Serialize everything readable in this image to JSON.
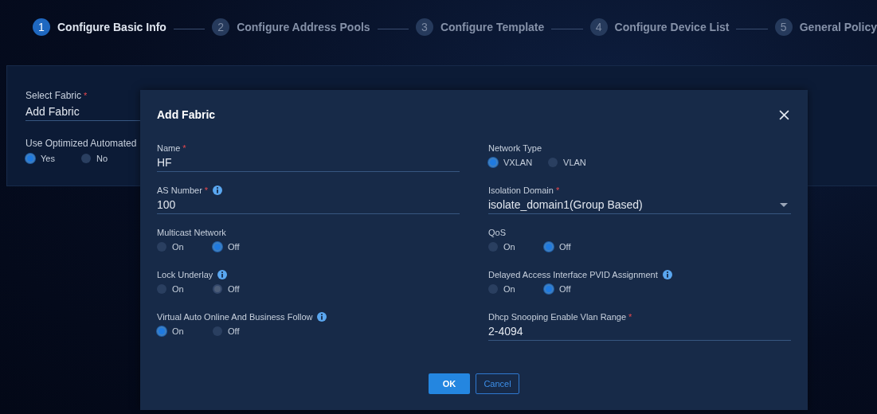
{
  "steps": [
    {
      "number": "1",
      "label": "Configure Basic Info",
      "selected": true
    },
    {
      "number": "2",
      "label": "Configure Address Pools",
      "selected": false
    },
    {
      "number": "3",
      "label": "Configure Template",
      "selected": false
    },
    {
      "number": "4",
      "label": "Configure Device List",
      "selected": false
    },
    {
      "number": "5",
      "label": "General Policy",
      "selected": false
    }
  ],
  "background_form": {
    "fields": [
      {
        "kind": "text",
        "label": "Select Fabric",
        "required_mark": "*",
        "value": "Add Fabric"
      },
      {
        "kind": "radio",
        "label": "Use Optimized Automated",
        "disabled": false,
        "options": [
          {
            "label": "Yes",
            "selected": true
          },
          {
            "label": "No",
            "selected": false
          }
        ]
      }
    ]
  },
  "dialog": {
    "title": "Add Fabric",
    "left_column": [
      {
        "kind": "text",
        "label": "Name",
        "required_mark": "*",
        "value": "HF"
      },
      {
        "kind": "text",
        "label": "AS Number",
        "required_mark": "*",
        "info": true,
        "value": "100"
      },
      {
        "kind": "radio",
        "label": "Multicast Network",
        "disabled": false,
        "options": [
          {
            "label": "On",
            "selected": false
          },
          {
            "label": "Off",
            "selected": true
          }
        ]
      },
      {
        "kind": "radio",
        "label": "Lock Underlay",
        "info": true,
        "disabled": true,
        "options": [
          {
            "label": "On",
            "selected": false
          },
          {
            "label": "Off",
            "selected": true
          }
        ]
      },
      {
        "kind": "radio",
        "label": "Virtual Auto Online And Business Follow",
        "info": true,
        "disabled": false,
        "options": [
          {
            "label": "On",
            "selected": true
          },
          {
            "label": "Off",
            "selected": false
          }
        ]
      }
    ],
    "right_column": [
      {
        "kind": "radio",
        "label": "Network Type",
        "disabled": false,
        "options": [
          {
            "label": "VXLAN",
            "selected": true
          },
          {
            "label": "VLAN",
            "selected": false
          }
        ]
      },
      {
        "kind": "select",
        "label": "Isolation Domain",
        "required_mark": "*",
        "value": "isolate_domain1(Group Based)"
      },
      {
        "kind": "radio",
        "label": "QoS",
        "disabled": false,
        "options": [
          {
            "label": "On",
            "selected": false
          },
          {
            "label": "Off",
            "selected": true
          }
        ]
      },
      {
        "kind": "radio",
        "label": "Delayed Access Interface PVID Assignment",
        "info": true,
        "disabled": false,
        "options": [
          {
            "label": "On",
            "selected": false
          },
          {
            "label": "Off",
            "selected": true
          }
        ]
      },
      {
        "kind": "text",
        "label": "Dhcp Snooping Enable Vlan Range",
        "required_mark": "*",
        "value": "2-4094"
      }
    ],
    "buttons": [
      {
        "kind": "primary",
        "label": "OK"
      },
      {
        "kind": "secondary",
        "label": "Cancel"
      }
    ]
  }
}
